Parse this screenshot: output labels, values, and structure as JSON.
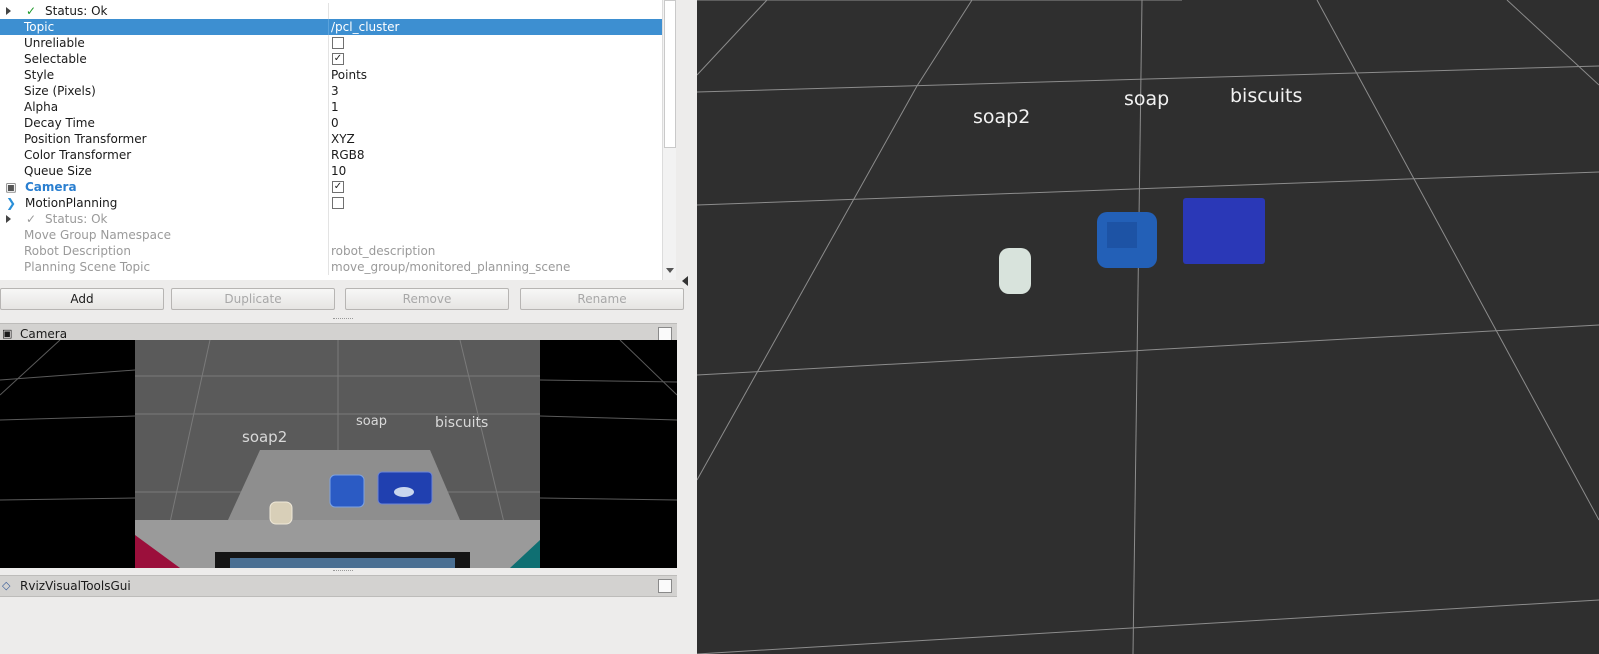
{
  "properties": {
    "rows": [
      {
        "label": "Status: Ok"
      },
      {
        "label": "Topic",
        "value": "/pcl_cluster"
      },
      {
        "label": "Unreliable"
      },
      {
        "label": "Selectable"
      },
      {
        "label": "Style",
        "value": "Points"
      },
      {
        "label": "Size (Pixels)",
        "value": "3"
      },
      {
        "label": "Alpha",
        "value": "1"
      },
      {
        "label": "Decay Time",
        "value": "0"
      },
      {
        "label": "Position Transformer",
        "value": "XYZ"
      },
      {
        "label": "Color Transformer",
        "value": "RGB8"
      },
      {
        "label": "Queue Size",
        "value": "10"
      },
      {
        "label": "Camera"
      },
      {
        "label": "MotionPlanning"
      },
      {
        "label": "Status: Ok"
      },
      {
        "label": "Move Group Namespace"
      },
      {
        "label": "Robot Description",
        "value": "robot_description"
      },
      {
        "label": "Planning Scene Topic",
        "value": "move_group/monitored_planning_scene"
      }
    ],
    "checks": {
      "unreliable": "",
      "selectable": "✓",
      "camera": "✓",
      "motion_planning": ""
    }
  },
  "buttons": {
    "add": "Add",
    "duplicate": "Duplicate",
    "remove": "Remove",
    "rename": "Rename"
  },
  "panels": {
    "camera": "Camera",
    "rviz_visual_tools": "RvizVisualToolsGui"
  },
  "scene_labels": {
    "soap2": "soap2",
    "soap": "soap",
    "biscuits": "biscuits"
  },
  "icons": {
    "status_ok": "checkmark-icon",
    "camera": "camera-icon",
    "motion": "motion-planning-icon",
    "expand": "expand-arrow-icon",
    "rviz": "rviz-tools-icon"
  },
  "colors": {
    "selection": "#3d8fd1",
    "camera_link": "#2a7fd0",
    "viewport_bg": "#2f2f2f",
    "soap2_cloud": "#d8e3dc",
    "soap_cloud": "#2360b7",
    "biscuits_cloud": "#2a38b7"
  }
}
